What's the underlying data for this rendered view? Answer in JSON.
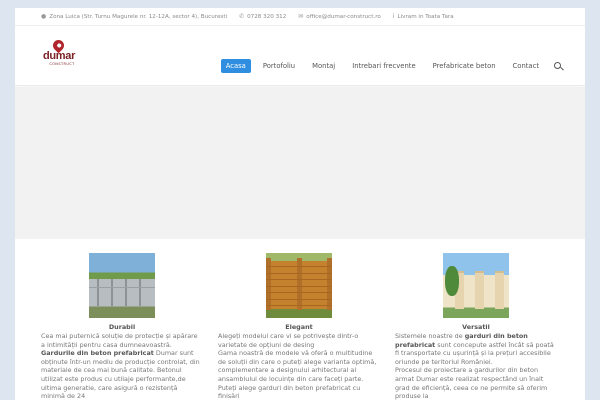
{
  "topbar": {
    "address": "Zona Luica (Str. Turnu Magurele nr. 12-12A, sector 4), Bucuresti",
    "phone": "0728 320 312",
    "email": "office@dumar-construct.ro",
    "delivery": "Livram in Toata Tara"
  },
  "logo": {
    "name": "dumar",
    "tagline": "CONSTRUCT"
  },
  "nav": {
    "items": [
      "Acasa",
      "Portofoliu",
      "Montaj",
      "Intrebari frecvente",
      "Prefabricate beton",
      "Contact"
    ],
    "active_index": 0
  },
  "features": [
    {
      "title": "Durabil",
      "text_pre": "Cea mai puternică soluție de protecție și apărare a intimității pentru casa dumneavoastră.",
      "bold": "Gardurile din beton prefabricat",
      "text_post": " Dumar sunt obținute într-un mediu de producție controlat, din materiale de cea mai bună calitate. Betonul utilizat este produs cu utilaje performante,de ultima generatie, care asigură o rezistență minimă de 24"
    },
    {
      "title": "Elegant",
      "text_pre": "Alegeți modelul care vi se potrivește dintr-o varietate de opțiuni de desing",
      "text_mid": "Gama noastră de modele vă oferă o multitudine de soluții din care o puteți alege varianta optimă, complementare a designului arhitectural al ansamblului de locuințe din care faceți parte. Puteți alege garduri din beton prefabricat cu finisări"
    },
    {
      "title": "Versatil",
      "text_pre": "Sistemele noastre de ",
      "bold": "garduri din beton prefabricat",
      "text_post": " sunt concepute astfel încât să poată fi transportate cu ușurință și la prețuri accesibile oriunde pe teritoriul României.",
      "text_extra": "Procesul de proiectare a gardurilor din beton armat Dumar este realizat respectând un înalt grad de eficiență, ceea ce ne permite să oferim produse la"
    }
  ],
  "colors": {
    "accent": "#2f8ee0",
    "brand": "#b0262c",
    "text": "#777777"
  },
  "icons": [
    "map-marker-icon",
    "phone-icon",
    "envelope-icon",
    "info-icon",
    "search-icon"
  ]
}
